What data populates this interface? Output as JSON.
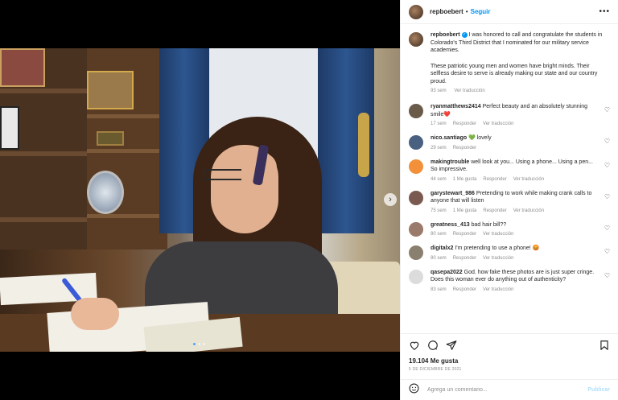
{
  "post": {
    "username": "repboebert",
    "follow_label": "Seguir",
    "caption": "I was honored to call and congratulate the students in Colorado's Third District that I nominated for our military service academies.",
    "caption_2": "These patriotic young men and women have bright minds. Their selfless desire to serve is already making our state and our country proud.",
    "caption_time": "93 sem",
    "caption_translate": "Ver traducción"
  },
  "comments": [
    {
      "user": "ryanmatthews2414",
      "text": "Perfect beauty and an absolutely stunning smile❤️",
      "time": "17 sem",
      "likes": "",
      "reply": "Responder",
      "translate": "Ver traducción",
      "avatar_color": "#6a5a4a"
    },
    {
      "user": "nico.santiago",
      "text": "💚 lovely",
      "time": "29 sem",
      "likes": "",
      "reply": "Responder",
      "translate": "",
      "avatar_color": "#4a6080"
    },
    {
      "user": "makingtrouble",
      "text": "well look at you... Using a phone... Using a pen... So impressive.",
      "time": "44 sem",
      "likes": "1 Me gusta",
      "reply": "Responder",
      "translate": "Ver traducción",
      "avatar_color": "#f2913a"
    },
    {
      "user": "garystewart_986",
      "text": "Pretending to work while making crank calls to anyone that will listen",
      "time": "75 sem",
      "likes": "1 Me gusta",
      "reply": "Responder",
      "translate": "Ver traducción",
      "avatar_color": "#7a5a50"
    },
    {
      "user": "greatness_413",
      "text": "bad hair bill??",
      "time": "80 sem",
      "likes": "",
      "reply": "Responder",
      "translate": "Ver traducción",
      "avatar_color": "#9a7a6a"
    },
    {
      "user": "digitalx2",
      "text": "I'm pretending to use a phone! 😡",
      "time": "80 sem",
      "likes": "",
      "reply": "Responder",
      "translate": "Ver traducción",
      "avatar_color": "#8a8070"
    },
    {
      "user": "qasepa2022",
      "text": "God. how fake these photos are is just super cringe. Does this woman ever do anything out of authenticity?",
      "time": "83 sem",
      "likes": "",
      "reply": "Responder",
      "translate": "Ver traducción",
      "avatar_color": "#dcdcdc"
    }
  ],
  "footer": {
    "likes": "19.104 Me gusta",
    "date": "5 DE DICIEMBRE DE 2021",
    "comment_placeholder": "Agrega un comentario...",
    "publish_label": "Publicar"
  },
  "icons": {
    "like": "heart-icon",
    "comment": "comment-icon",
    "share": "share-icon",
    "save": "bookmark-icon",
    "emoji": "emoji-icon",
    "more": "more-icon",
    "next": "chevron-right-icon"
  },
  "colors": {
    "accent": "#0095f6",
    "text": "#262626",
    "muted": "#8e8e8e"
  }
}
